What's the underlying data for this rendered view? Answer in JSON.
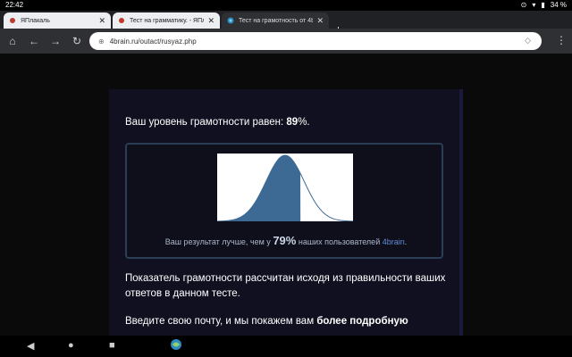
{
  "status": {
    "time": "22:42",
    "battery": "34 %",
    "icons": [
      "cast-icon",
      "wifi-icon",
      "battery-icon"
    ]
  },
  "tabs": [
    {
      "title": "ЯПлакаль",
      "favicon": "yaplakal-favicon-icon",
      "active": false
    },
    {
      "title": "Тест на грамматику. - ЯПла",
      "favicon": "yaplakal-favicon-icon",
      "active": false
    },
    {
      "title": "Тест на грамотность от 4b",
      "favicon": "4brain-favicon-icon",
      "active": true
    }
  ],
  "toolbar": {
    "url": "4brain.ru/outact/rusyaz.php"
  },
  "content": {
    "level_prefix": "Ваш уровень грамотности равен: ",
    "level_value": "89",
    "level_suffix": "%.",
    "better_prefix": "Ваш результат лучше, чем у ",
    "better_pct": "79%",
    "better_middle": " наших пользователей ",
    "better_brand": "4brain",
    "better_suffix": ".",
    "para1": "Показатель грамотности рассчитан исходя из правильности ваших ответов в данном тесте.",
    "para2_prefix": "Введите свою почту, и мы покажем вам ",
    "para2_bold": "более подробную"
  },
  "chart_data": {
    "type": "area",
    "percentile_fill": 0.79,
    "fill_color": "#3d6a94",
    "background_color": "#ffffff"
  }
}
